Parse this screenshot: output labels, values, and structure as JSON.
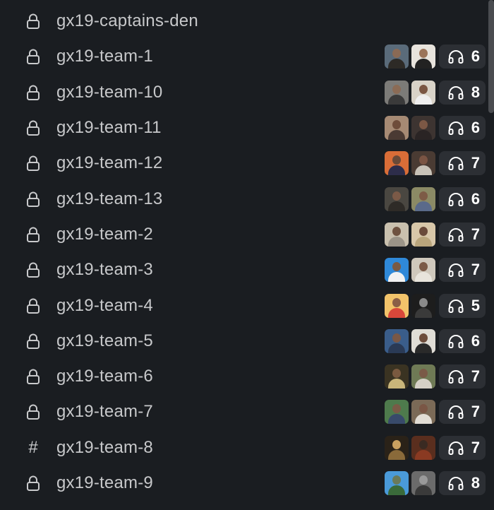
{
  "channels": [
    {
      "name": "gx19-captains-den",
      "icon": "lock-icon",
      "huddle": null
    },
    {
      "name": "gx19-team-1",
      "icon": "lock-icon",
      "huddle": {
        "count": "6",
        "avatars": [
          {
            "bg": "#5a6b7a",
            "head": "#8a6a55",
            "body": "#2d2a26"
          },
          {
            "bg": "#e8e4dd",
            "head": "#9b7459",
            "body": "#222222"
          }
        ]
      }
    },
    {
      "name": "gx19-team-10",
      "icon": "lock-icon",
      "huddle": {
        "count": "8",
        "avatars": [
          {
            "bg": "#7c7b78",
            "head": "#8b6b55",
            "body": "#3a3a3a"
          },
          {
            "bg": "#d9d3c8",
            "head": "#7a5643",
            "body": "#efefef"
          }
        ]
      }
    },
    {
      "name": "gx19-team-11",
      "icon": "lock-icon",
      "huddle": {
        "count": "6",
        "avatars": [
          {
            "bg": "#a68a74",
            "head": "#6e4c3a",
            "body": "#4a3a33"
          },
          {
            "bg": "#3d3431",
            "head": "#7c5845",
            "body": "#2a2424"
          }
        ]
      }
    },
    {
      "name": "gx19-team-12",
      "icon": "lock-icon",
      "huddle": {
        "count": "7",
        "avatars": [
          {
            "bg": "#d96d37",
            "head": "#6a4a38",
            "body": "#2d2d4a"
          },
          {
            "bg": "#4a3b33",
            "head": "#7a5443",
            "body": "#c8c2b8"
          }
        ]
      }
    },
    {
      "name": "gx19-team-13",
      "icon": "lock-icon",
      "huddle": {
        "count": "6",
        "avatars": [
          {
            "bg": "#4a4741",
            "head": "#7b5a47",
            "body": "#2e2b27"
          },
          {
            "bg": "#8b8a65",
            "head": "#7d5b46",
            "body": "#5a6a8a"
          }
        ]
      }
    },
    {
      "name": "gx19-team-2",
      "icon": "lock-icon",
      "huddle": {
        "count": "7",
        "avatars": [
          {
            "bg": "#c9c0ae",
            "head": "#6e5240",
            "body": "#9b9488"
          },
          {
            "bg": "#d8c7a9",
            "head": "#6a4a3a",
            "body": "#b9a57c"
          }
        ]
      }
    },
    {
      "name": "gx19-team-3",
      "icon": "lock-icon",
      "huddle": {
        "count": "7",
        "avatars": [
          {
            "bg": "#2f89d9",
            "head": "#7a5a44",
            "body": "#f2f2f2"
          },
          {
            "bg": "#cfc8bc",
            "head": "#7b5a47",
            "body": "#e8e4dc"
          }
        ]
      }
    },
    {
      "name": "gx19-team-4",
      "icon": "lock-icon",
      "huddle": {
        "count": "5",
        "avatars": [
          {
            "bg": "#f2c36a",
            "head": "#8a5e46",
            "body": "#d9473a"
          },
          {
            "bg": "#1d1d1d",
            "head": "#8a8a8a",
            "body": "#3a3a3a"
          }
        ]
      }
    },
    {
      "name": "gx19-team-5",
      "icon": "lock-icon",
      "huddle": {
        "count": "6",
        "avatars": [
          {
            "bg": "#3a5d8a",
            "head": "#7a5846",
            "body": "#2a3a55"
          },
          {
            "bg": "#e0ddd6",
            "head": "#6d4d3c",
            "body": "#2a2a2a"
          }
        ]
      }
    },
    {
      "name": "gx19-team-6",
      "icon": "lock-icon",
      "huddle": {
        "count": "7",
        "avatars": [
          {
            "bg": "#3a3322",
            "head": "#7a5a40",
            "body": "#c9b57a"
          },
          {
            "bg": "#6f7a55",
            "head": "#7a5a47",
            "body": "#d5d0c6"
          }
        ]
      }
    },
    {
      "name": "gx19-team-7",
      "icon": "lock-icon",
      "huddle": {
        "count": "7",
        "avatars": [
          {
            "bg": "#4e7a4c",
            "head": "#7a5a46",
            "body": "#384a6a"
          },
          {
            "bg": "#7b6a57",
            "head": "#7a5645",
            "body": "#e2ddd5"
          }
        ]
      }
    },
    {
      "name": "gx19-team-8",
      "icon": "hash-icon",
      "huddle": {
        "count": "7",
        "avatars": [
          {
            "bg": "#2a2218",
            "head": "#c9a060",
            "body": "#8a6a3a"
          },
          {
            "bg": "#5a2e1e",
            "head": "#3a2a22",
            "body": "#8a3a22"
          }
        ]
      }
    },
    {
      "name": "gx19-team-9",
      "icon": "lock-icon",
      "huddle": {
        "count": "8",
        "avatars": [
          {
            "bg": "#4a9ad9",
            "head": "#6a7a5a",
            "body": "#3a6a3a"
          },
          {
            "bg": "#6b6b6b",
            "head": "#9a9a9a",
            "body": "#3a3a3a"
          }
        ]
      }
    }
  ],
  "colors": {
    "background": "#1a1d21",
    "text": "#c7c8ca",
    "pill": "#2c2f34"
  }
}
